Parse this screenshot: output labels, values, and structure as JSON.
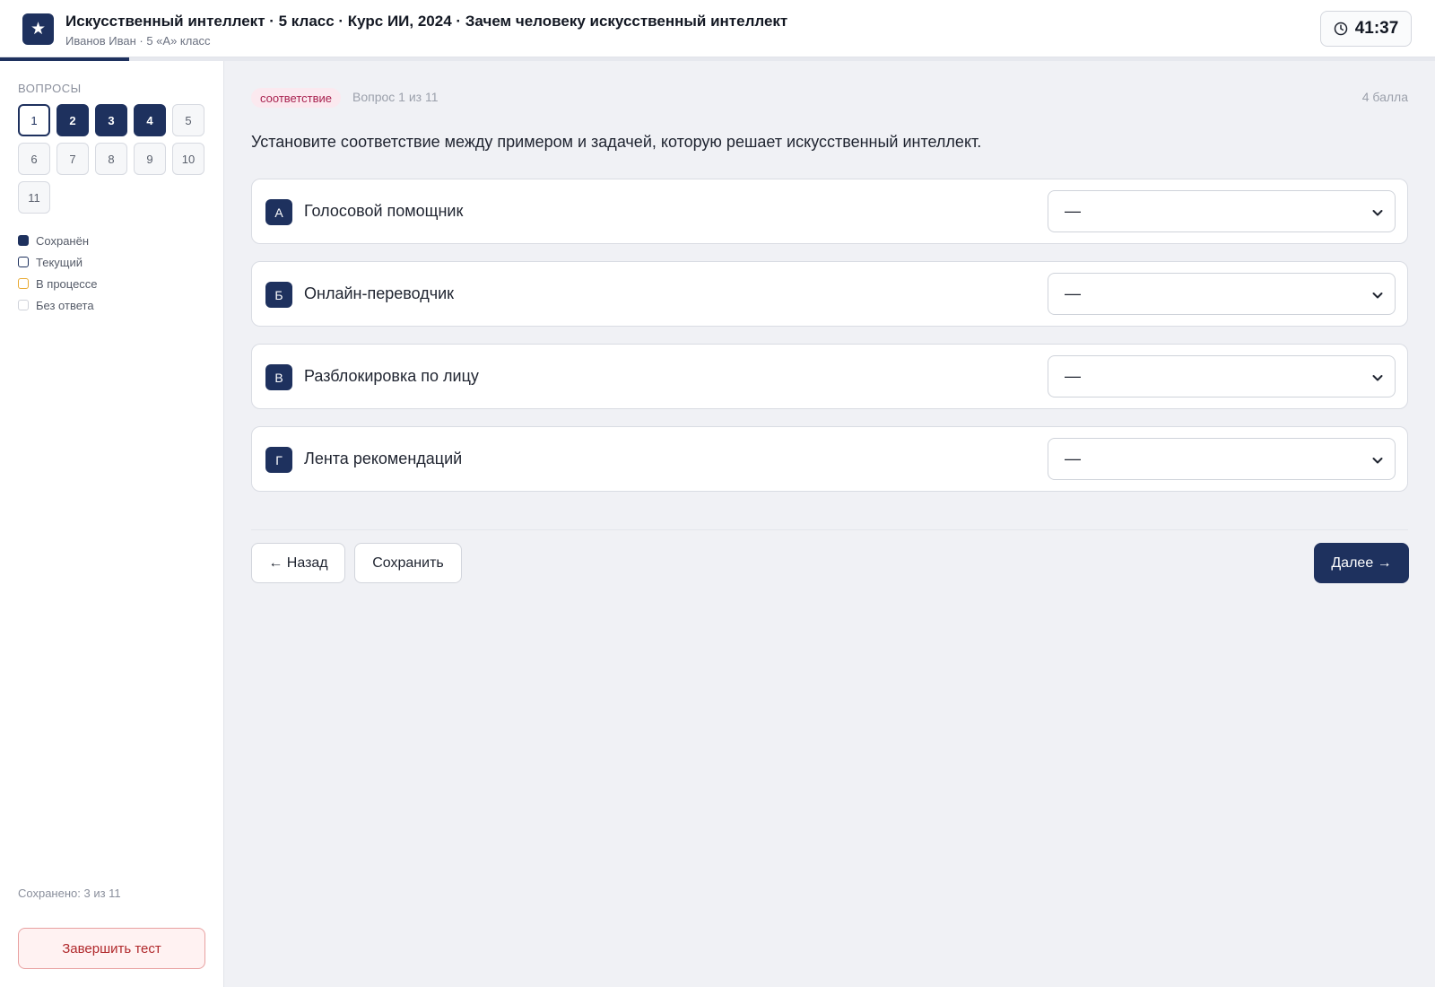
{
  "header": {
    "logo_glyph": "★",
    "title": "Искусственный интеллект · 5 класс · Курс ИИ, 2024 · Зачем человеку искусственный интеллект",
    "subtitle": "Иванов Иван · 5 «А» класс",
    "timer": "41:37",
    "timer_icon": "clock-icon",
    "progress_fraction": 0.09
  },
  "sidebar": {
    "title": "ВОПРОСЫ",
    "questions": [
      {
        "label": "1",
        "state": "current"
      },
      {
        "label": "2",
        "state": "saved"
      },
      {
        "label": "3",
        "state": "saved"
      },
      {
        "label": "4",
        "state": "saved"
      },
      {
        "label": "5",
        "state": "empty"
      },
      {
        "label": "6",
        "state": "empty"
      },
      {
        "label": "7",
        "state": "empty"
      },
      {
        "label": "8",
        "state": "empty"
      },
      {
        "label": "9",
        "state": "empty"
      },
      {
        "label": "10",
        "state": "empty"
      },
      {
        "label": "11",
        "state": "empty"
      }
    ],
    "legend": [
      {
        "label": "Сохранён",
        "state": "saved"
      },
      {
        "label": "Текущий",
        "state": "current"
      },
      {
        "label": "В процессе",
        "state": "progress"
      },
      {
        "label": "Без ответа",
        "state": "empty"
      }
    ],
    "saved_count": "Сохранено: 3 из 11",
    "finish_label": "Завершить тест"
  },
  "main": {
    "badge": "соответствие",
    "question_count": "Вопрос 1 из 11",
    "points": "4 балла",
    "question": "Установите соответствие между примером и задачей, которую решает искусственный интеллект.",
    "pairs": [
      {
        "letter": "А",
        "label": "Голосовой помощник",
        "selected": "—"
      },
      {
        "letter": "Б",
        "label": "Онлайн-переводчик",
        "selected": "—"
      },
      {
        "letter": "В",
        "label": "Разблокировка по лицу",
        "selected": "—"
      },
      {
        "letter": "Г",
        "label": "Лента рекомендаций",
        "selected": "—"
      }
    ],
    "back_label": "← Назад",
    "save_label": "Сохранить",
    "next_label": "Далее →"
  },
  "colors": {
    "accent": "#1e315e",
    "badge_bg": "#fbe9ef",
    "badge_text": "#a8214f",
    "finish_border": "#e8a0a0",
    "in_progress": "#e8a930"
  }
}
